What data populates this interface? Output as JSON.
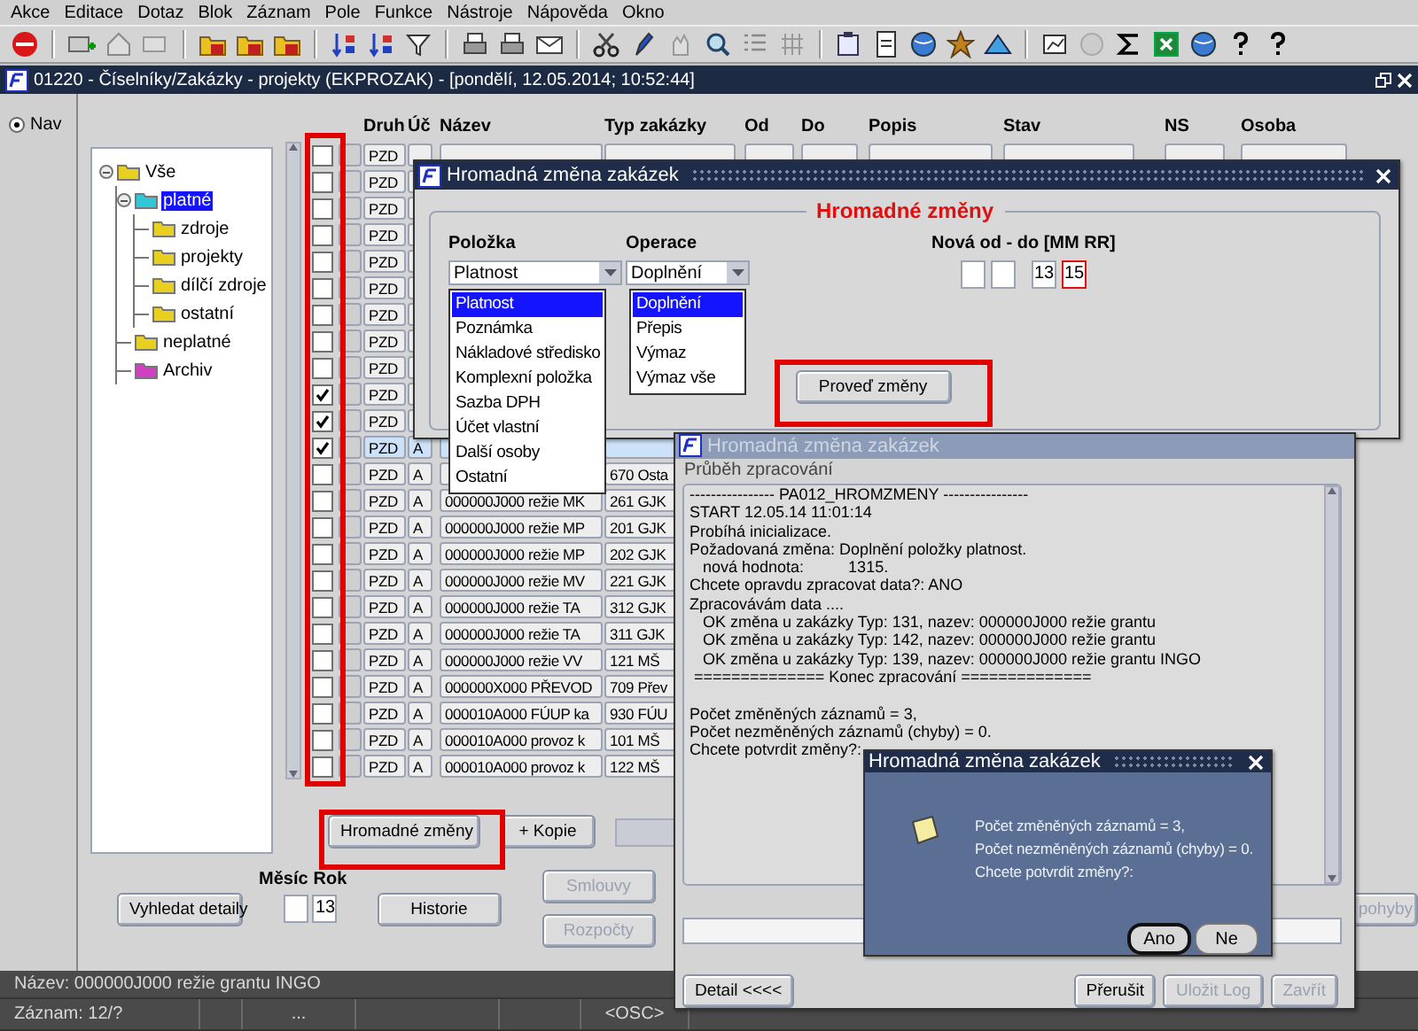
{
  "menu": [
    "Akce",
    "Editace",
    "Dotaz",
    "Blok",
    "Záznam",
    "Pole",
    "Funkce",
    "Nástroje",
    "Nápověda",
    "Okno"
  ],
  "window": {
    "title": "01220 - Číselníky/Zakázky - projekty (EKPROZAK) - [pondělí, 12.05.2014; 10:52:44]"
  },
  "nav": {
    "label": "Nav",
    "selected": true
  },
  "tree": [
    {
      "label": "Vše",
      "color": "#e8d020",
      "selected": false,
      "children": [
        {
          "label": "platné",
          "color": "#30c8d8",
          "selected": true,
          "children": [
            {
              "label": "zdroje",
              "color": "#e8d020",
              "selected": false
            },
            {
              "label": "projekty",
              "color": "#e8d020",
              "selected": false
            },
            {
              "label": "dílčí zdroje",
              "color": "#e8d020",
              "selected": false
            },
            {
              "label": "ostatní",
              "color": "#e8d020",
              "selected": false
            }
          ]
        },
        {
          "label": "neplatné",
          "color": "#e8d020",
          "selected": false
        },
        {
          "label": "Archiv",
          "color": "#d040c0",
          "selected": false
        }
      ]
    }
  ],
  "grid": {
    "columns": [
      "Druh",
      "Úč",
      "Název",
      "Typ zakázky",
      "Od",
      "Do",
      "Popis",
      "Stav",
      "NS",
      "Osoba"
    ],
    "rows": [
      {
        "checked": false,
        "selected": false,
        "druh": "PZD"
      },
      {
        "checked": false,
        "selected": false,
        "druh": "PZD"
      },
      {
        "checked": false,
        "selected": false,
        "druh": "PZD"
      },
      {
        "checked": false,
        "selected": false,
        "druh": "PZD"
      },
      {
        "checked": false,
        "selected": false,
        "druh": "PZD"
      },
      {
        "checked": false,
        "selected": false,
        "druh": "PZD"
      },
      {
        "checked": false,
        "selected": false,
        "druh": "PZD"
      },
      {
        "checked": false,
        "selected": false,
        "druh": "PZD"
      },
      {
        "checked": false,
        "selected": false,
        "druh": "PZD"
      },
      {
        "checked": true,
        "selected": false,
        "druh": "PZD"
      },
      {
        "checked": true,
        "selected": false,
        "druh": "PZD"
      },
      {
        "checked": true,
        "selected": true,
        "druh": "PZD",
        "uc": "A"
      },
      {
        "checked": false,
        "selected": false,
        "druh": "PZD",
        "uc": "A",
        "typ": "670 Osta"
      },
      {
        "checked": false,
        "selected": false,
        "druh": "PZD",
        "uc": "A",
        "nazev": "000000J000 režie MK",
        "typ": "261 GJK"
      },
      {
        "checked": false,
        "selected": false,
        "druh": "PZD",
        "uc": "A",
        "nazev": "000000J000 režie MP",
        "typ": "201 GJK"
      },
      {
        "checked": false,
        "selected": false,
        "druh": "PZD",
        "uc": "A",
        "nazev": "000000J000 režie MP",
        "typ": "202 GJK"
      },
      {
        "checked": false,
        "selected": false,
        "druh": "PZD",
        "uc": "A",
        "nazev": "000000J000 režie MV",
        "typ": "221 GJK"
      },
      {
        "checked": false,
        "selected": false,
        "druh": "PZD",
        "uc": "A",
        "nazev": "000000J000 režie TA",
        "typ": "312 GJK"
      },
      {
        "checked": false,
        "selected": false,
        "druh": "PZD",
        "uc": "A",
        "nazev": "000000J000 režie TA",
        "typ": "311 GJK"
      },
      {
        "checked": false,
        "selected": false,
        "druh": "PZD",
        "uc": "A",
        "nazev": "000000J000 režie VV",
        "typ": "121 MŠ"
      },
      {
        "checked": false,
        "selected": false,
        "druh": "PZD",
        "uc": "A",
        "nazev": "000000X000 PŘEVOD",
        "typ": "709 Přev"
      },
      {
        "checked": false,
        "selected": false,
        "druh": "PZD",
        "uc": "A",
        "nazev": "000010A000 FÚUP ka",
        "typ": "930 FÚU"
      },
      {
        "checked": false,
        "selected": false,
        "druh": "PZD",
        "uc": "A",
        "nazev": "000010A000 provoz k",
        "typ": "101 MŠ"
      },
      {
        "checked": false,
        "selected": false,
        "druh": "PZD",
        "uc": "A",
        "nazev": "000010A000 provoz k",
        "typ": "122 MŠ"
      }
    ]
  },
  "grid_buttons": [
    {
      "label": "Hromadné změny"
    },
    {
      "label": "+ Kopie"
    }
  ],
  "bottom": {
    "search_button": "Vyhledat detaily",
    "month_label": "Měsíc",
    "year_label": "Rok",
    "year": "13",
    "history_button": "Historie",
    "buttons": [
      {
        "label": "Smlouvy",
        "disabled": true
      },
      {
        "label": "Rozpočty",
        "disabled": true
      }
    ],
    "right_button": {
      "label": "pohyby",
      "disabled": true
    }
  },
  "status_bar": {
    "line": "Název: 000000J000 režie grantu INGO",
    "record": "Záznam: 12/?",
    "ellipsis": "...",
    "mode": "<OSC>"
  },
  "bulk_dialog": {
    "title": "Hromadná změna zakázek",
    "active": true,
    "group": "Hromadné změny",
    "item_label": "Položka",
    "item_value": "Platnost",
    "item_options": [
      {
        "label": "Platnost",
        "selected": true
      },
      {
        "label": "Poznámka",
        "selected": false
      },
      {
        "label": "Nákladové středisko",
        "selected": false
      },
      {
        "label": "Komplexní položka",
        "selected": false
      },
      {
        "label": "Sazba DPH",
        "selected": false
      },
      {
        "label": "Účet vlastní",
        "selected": false
      },
      {
        "label": "Další osoby",
        "selected": false
      },
      {
        "label": "Ostatní",
        "selected": false
      }
    ],
    "operation_label": "Operace",
    "operation_value": "Doplnění",
    "operation_options": [
      {
        "label": "Doplnění",
        "selected": true
      },
      {
        "label": "Přepis",
        "selected": false
      },
      {
        "label": "Výmaz",
        "selected": false
      },
      {
        "label": "Výmaz vše",
        "selected": false
      }
    ],
    "range_label": "Nová od - do [MM RR]",
    "range_fields": [
      {
        "invalid": false
      },
      {
        "invalid": false
      },
      {
        "value": "13",
        "invalid": false
      },
      {
        "value": "15",
        "invalid": true
      }
    ],
    "apply_button": "Proveď změny"
  },
  "progress_dialog": {
    "title": "Hromadná změna zakázek",
    "active": false,
    "section": "Průběh zpracování",
    "log": [
      {
        "lines": [
          "---------------- PA012_HROMZMENY ----------------",
          "START 12.05.14 11:01:14",
          "Probíhá inicializace.",
          "Požadovaná změna: Doplnění položky platnost.",
          "   nová hodnota:          1315.",
          "Chcete opravdu zpracovat data?: ANO",
          "Zpracovávám data ....",
          "   OK změna u zakázky Typ: 131, nazev: 000000J000 režie grantu",
          "   OK změna u zakázky Typ: 142, nazev: 000000J000 režie grantu",
          "   OK změna u zakázky Typ: 139, nazev: 000000J000 režie grantu INGO",
          " ============== Konec zpracování =============="
        ]
      },
      {
        "lines": [
          "Počet změněných záznamů = 3,",
          "Počet nezměněných záznamů (chyby) = 0.",
          "Chcete potvrdit změny?:"
        ]
      }
    ],
    "buttons": [
      {
        "label": "Detail <<<<",
        "disabled": false
      },
      {
        "label": "Přerušit",
        "disabled": false
      },
      {
        "label": "Uložit Log",
        "disabled": true
      },
      {
        "label": "Zavřít",
        "disabled": true
      }
    ]
  },
  "confirm_dialog": {
    "title": "Hromadná změna zakázek",
    "active": true,
    "message": [
      "Počet změněných záznamů = 3,",
      "Počet nezměněných záznamů (chyby) = 0.",
      "Chcete potvrdit změny?:"
    ],
    "buttons": [
      {
        "label": "Ano",
        "default": true
      },
      {
        "label": "Ne",
        "default": false
      }
    ]
  }
}
